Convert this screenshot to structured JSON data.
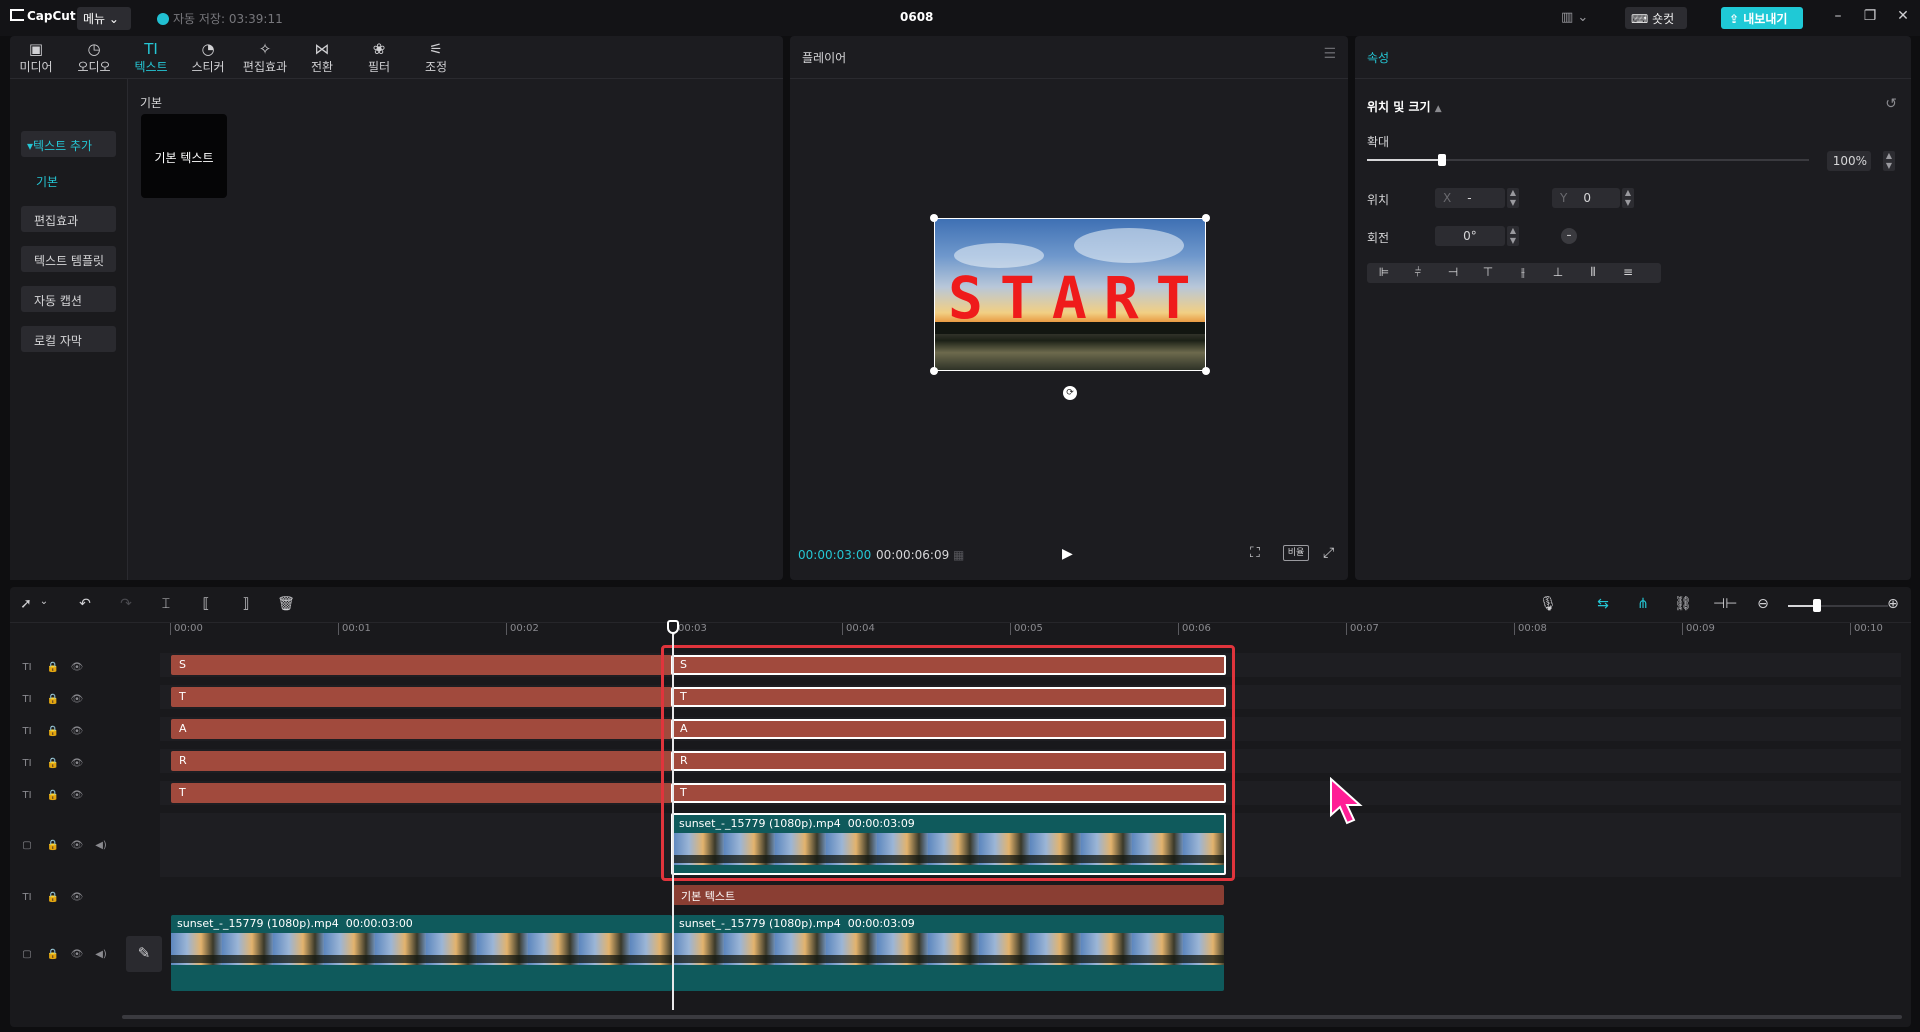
{
  "app": {
    "logo": "CapCut",
    "menu_label": "메뉴",
    "autosave": "자동 저장: 03:39:11",
    "project_title": "0608",
    "shortcut_label": "숏컷",
    "export_label": "내보내기",
    "brand_color": "#1fc9d6"
  },
  "toolbar": {
    "tabs": [
      {
        "label": "미디어",
        "icon": "media-icon"
      },
      {
        "label": "오디오",
        "icon": "audio-icon"
      },
      {
        "label": "텍스트",
        "icon": "text-icon"
      },
      {
        "label": "스티커",
        "icon": "sticker-icon"
      },
      {
        "label": "편집효과",
        "icon": "effects-icon"
      },
      {
        "label": "전환",
        "icon": "transition-icon"
      },
      {
        "label": "필터",
        "icon": "filter-icon"
      },
      {
        "label": "조정",
        "icon": "adjust-icon"
      }
    ],
    "active": "텍스트"
  },
  "sidebar": {
    "items": [
      {
        "label": "텍스트 추가"
      },
      {
        "label": "기본"
      },
      {
        "label": "편집효과"
      },
      {
        "label": "텍스트 템플릿"
      },
      {
        "label": "자동 캡션"
      },
      {
        "label": "로컬 자막"
      }
    ]
  },
  "library": {
    "section": "기본",
    "card": "기본 텍스트"
  },
  "player": {
    "title": "플레이어",
    "overlay_text": "START",
    "current_time": "00:00:03:00",
    "total_time": "00:00:06:09",
    "ratio_label": "비율"
  },
  "properties": {
    "title": "속성",
    "group": "위치 및 크기",
    "scale_label": "확대",
    "scale_value": "100%",
    "scale_level": 0.17,
    "position_label": "위치",
    "x_prefix": "X",
    "x_value": "-",
    "y_prefix": "Y",
    "y_value": "0",
    "rotation_label": "회전",
    "rotation_value": "0°"
  },
  "timeline": {
    "ruler": [
      "00:00",
      "00:01",
      "00:02",
      "00:03",
      "00:04",
      "00:05",
      "00:06",
      "00:07",
      "00:08",
      "00:09",
      "00:10"
    ],
    "text_tracks": [
      "S",
      "T",
      "A",
      "R",
      "T"
    ],
    "overlay_clip": {
      "name": "sunset_-_15779 (1080p).mp4",
      "duration": "00:00:03:09"
    },
    "base_text_clip": "기본 텍스트",
    "main_clip_a": {
      "name": "sunset_-_15779 (1080p).mp4",
      "duration": "00:00:03:00"
    },
    "main_clip_b": {
      "name": "sunset_-_15779 (1080p).mp4",
      "duration": "00:00:03:09"
    },
    "highlight_color": "#e0343c",
    "text_clip_color": "#a14a3d",
    "video_clip_color": "#0f5a5c"
  }
}
